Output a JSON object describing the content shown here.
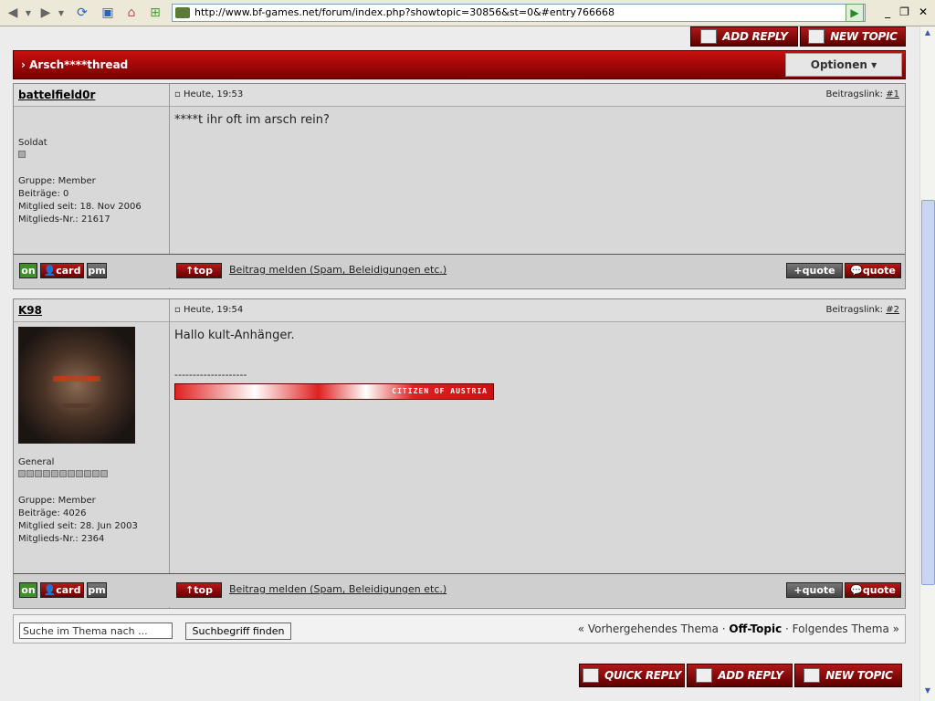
{
  "browser": {
    "url": "http://www.bf-games.net/forum/index.php?showtopic=30856&st=0&#entry766668"
  },
  "topbuttons": {
    "add_reply": "ADD REPLY",
    "new_topic": "NEW TOPIC"
  },
  "thread": {
    "title": "Arsch****thread",
    "options": "Optionen"
  },
  "posts": [
    {
      "author": "battelfield0r",
      "date": "Heute, 19:53",
      "link_label": "Beitragslink:",
      "link_num": "#1",
      "rank": "Soldat",
      "group": "Gruppe: Member",
      "posts": "Beiträge: 0",
      "since": "Mitglied seit: 18. Nov 2006",
      "memberno": "Mitglieds-Nr.: 21617",
      "text": "****t ihr oft im arsch rein?"
    },
    {
      "author": "K98",
      "date": "Heute, 19:54",
      "link_label": "Beitragslink:",
      "link_num": "#2",
      "rank": "General",
      "group": "Gruppe: Member",
      "posts": "Beiträge: 4026",
      "since": "Mitglied seit: 28. Jun 2003",
      "memberno": "Mitglieds-Nr.: 2364",
      "text": "Hallo kult-Anhänger.",
      "sig_sep": "--------------------",
      "sig_label": "CITIZEN OF AUSTRIA"
    }
  ],
  "postbuttons": {
    "on": "on",
    "card": "card",
    "pm": "pm",
    "top": "top",
    "report": "Beitrag melden (Spam, Beleidigungen etc.)",
    "quote1": "quote",
    "quote2": "quote"
  },
  "bottom": {
    "search_placeholder": "Suche im Thema nach ...",
    "search_button": "Suchbegriff finden",
    "prev": "« Vorhergehendes Thema",
    "forum": "Off-Topic",
    "next": "Folgendes Thema »",
    "quick_reply": "QUICK REPLY",
    "add_reply": "ADD REPLY",
    "new_topic": "NEW TOPIC"
  }
}
